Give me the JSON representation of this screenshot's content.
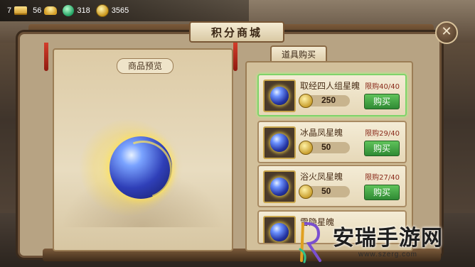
{
  "topbar": {
    "resources": [
      {
        "icon": "ingot-icon",
        "value": "7"
      },
      {
        "icon": "gold-icon",
        "value": "56"
      },
      {
        "icon": "jade-icon",
        "value": "318"
      },
      {
        "icon": "coin-icon",
        "value": "3565"
      }
    ]
  },
  "window": {
    "title": "积分商城",
    "close_label": "✕"
  },
  "preview": {
    "label": "商品预览"
  },
  "shop": {
    "tab_label": "道具购买",
    "items": [
      {
        "name": "取经四人组星魄",
        "limit": "限购40/40",
        "price": "250",
        "buy_label": "购买"
      },
      {
        "name": "冰晶凤星魄",
        "limit": "限购29/40",
        "price": "50",
        "buy_label": "购买"
      },
      {
        "name": "浴火凤星魄",
        "limit": "限购27/40",
        "price": "50",
        "buy_label": "购买"
      },
      {
        "name": "雷隐星魄"
      }
    ]
  },
  "watermark": {
    "brand": "安瑞手游网",
    "url": "www.szerg.com"
  }
}
